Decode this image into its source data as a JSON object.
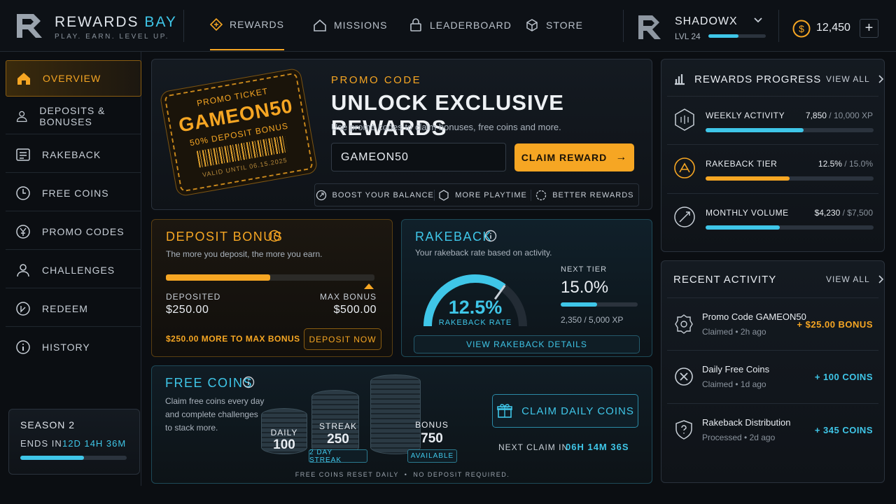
{
  "brand": {
    "name_a": "REWARDS",
    "name_b": "BAY",
    "tagline": "PLAY. EARN. LEVEL UP."
  },
  "nav": [
    {
      "label": "REWARDS",
      "icon": "gift-icon",
      "active": true
    },
    {
      "label": "MISSIONS",
      "icon": "home-icon"
    },
    {
      "label": "LEADERBOARD",
      "icon": "lock-icon"
    },
    {
      "label": "STORE",
      "icon": "cube-icon"
    }
  ],
  "user": {
    "name": "SHADOWX",
    "level": "LVL 24",
    "level_progress": 0.52,
    "balance": "12,450",
    "add": "+"
  },
  "sidebar": {
    "items": [
      {
        "label": "OVERVIEW",
        "icon": "home-icon"
      },
      {
        "label": "DEPOSITS & BONUSES",
        "icon": "users-icon"
      },
      {
        "label": "RAKEBACK",
        "icon": "document-icon"
      },
      {
        "label": "FREE COINS",
        "icon": "clock-icon"
      },
      {
        "label": "PROMO CODES",
        "icon": "yen-coin-icon"
      },
      {
        "label": "CHALLENGES",
        "icon": "user-icon"
      },
      {
        "label": "REDEEM",
        "icon": "ticket-icon"
      },
      {
        "label": "HISTORY",
        "icon": "info-icon"
      }
    ],
    "season": {
      "title": "SEASON 2",
      "ends_label": "ENDS IN",
      "ends_value": "12D 14H 36M",
      "progress": 0.6
    }
  },
  "promo": {
    "ticket_title": "PROMO TICKET",
    "ticket_code": "GAMEON50",
    "ticket_sub": "50% DEPOSIT BONUS",
    "ticket_valid": "VALID UNTIL 06.15.2025",
    "label": "PROMO CODE",
    "heading": "UNLOCK EXCLUSIVE REWARDS",
    "desc": "Use promo codes to claim bonuses, free coins and more.",
    "input_value": "GAMEON50",
    "claim": "CLAIM REWARD",
    "claim_arrow": "→",
    "perks": [
      "BOOST YOUR BALANCE",
      "MORE PLAYTIME",
      "BETTER REWARDS"
    ]
  },
  "deposit": {
    "title": "DEPOSIT BONUS",
    "desc": "The more you deposit, the more you earn.",
    "progress": 0.5,
    "deposited_label": "DEPOSITED",
    "deposited_value": "$250.00",
    "max_label": "MAX BONUS",
    "max_value": "$500.00",
    "remaining": "$250.00 MORE TO MAX BONUS",
    "button": "DEPOSIT NOW"
  },
  "rakeback": {
    "title": "RAKEBACK",
    "desc": "Your rakeback rate based on activity.",
    "rate": "12.5%",
    "rate_label": "RAKEBACK RATE",
    "gauge_fraction": 0.7,
    "next_label": "NEXT TIER",
    "next_value": "15.0%",
    "xp": "2,350 / 5,000 XP",
    "xp_progress": 0.47,
    "button": "VIEW RAKEBACK DETAILS"
  },
  "freecoins": {
    "title": "FREE COINS",
    "desc": [
      "Claim free coins every day",
      "and complete challenges",
      "to stack more."
    ],
    "stacks": [
      {
        "label": "DAILY",
        "value": "100"
      },
      {
        "label": "STREAK",
        "value": "250",
        "badge": "2 DAY STREAK"
      },
      {
        "label": "BONUS",
        "value": "750",
        "badge": "AVAILABLE"
      }
    ],
    "claim": "CLAIM DAILY COINS",
    "next_label": "NEXT CLAIM IN",
    "next_value": "06H 14M 36S",
    "footer": "FREE COINS RESET DAILY  •  NO DEPOSIT REQUIRED."
  },
  "progress": {
    "title": "REWARDS PROGRESS",
    "view_all": "VIEW ALL",
    "items": [
      {
        "label": "WEEKLY ACTIVITY",
        "value": "7,850",
        "max": "/ 10,000 XP",
        "fraction": 0.585,
        "color": "#3fc6e8"
      },
      {
        "label": "RAKEBACK TIER",
        "value": "12.5%",
        "max": "/ 15.0%",
        "fraction": 0.5,
        "color": "#f6a623"
      },
      {
        "label": "MONTHLY VOLUME",
        "value": "$4,230",
        "max": "/ $7,500",
        "fraction": 0.44,
        "color": "#3fc6e8"
      }
    ]
  },
  "activity": {
    "title": "RECENT ACTIVITY",
    "view_all": "VIEW ALL",
    "items": [
      {
        "title": "Promo Code GAMEON50",
        "status": "Claimed",
        "time": "2h ago",
        "amount": "+ $25.00 BONUS",
        "color": "#f6a623"
      },
      {
        "title": "Daily Free Coins",
        "status": "Claimed",
        "time": "1d ago",
        "amount": "+ 100 COINS",
        "color": "#3fc6e8"
      },
      {
        "title": "Rakeback Distribution",
        "status": "Processed",
        "time": "2d ago",
        "amount": "+ 345 COINS",
        "color": "#3fc6e8"
      }
    ]
  },
  "colors": {
    "accent": "#f6a623",
    "secondary": "#3fc6e8",
    "bg": "#0b0e12"
  }
}
